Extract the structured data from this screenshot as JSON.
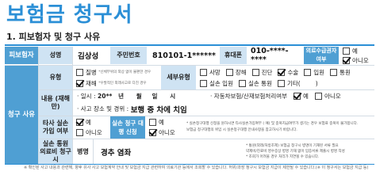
{
  "doc": {
    "title": "보험금 청구서",
    "section_title": "1. 피보험자 및 청구 사유"
  },
  "insured": {
    "header": "피보험자",
    "name_label": "성명",
    "name_value": "김상성",
    "rrn_label": "주민번호",
    "rrn_value": "810101-1******",
    "phone_label": "휴대폰",
    "phone_value": "010-****-****",
    "medical_label": "의료수급권자 여부",
    "medical_yes": "예",
    "medical_no": "아니오",
    "medical_selected": "아니오"
  },
  "claim": {
    "header": "청구 사유",
    "type_label": "유형",
    "type_disease": "질병",
    "type_disease_note": "*신체부위의 외상 없이 불편한 경우",
    "type_accident": "재해",
    "type_accident_note": "*우발적인 외래사고로 다친 경우",
    "detail_type_label": "세부유형",
    "detail_options": [
      "사망",
      "장해",
      "진단",
      "수술",
      "입원",
      "통원"
    ],
    "detail_options2": [
      "실손 입원",
      "실손 통원",
      "기타"
    ],
    "detail_selected": [
      "수술"
    ],
    "content_label": "내용 (재해만)",
    "datetime_prefix": "· 일시 :",
    "datetime_value": "20**   년      월     일      시",
    "auto_label": "· 자동차보험/산재보험처리여부",
    "auto_yes": "예",
    "auto_no": "아니오",
    "auto_selected": "예",
    "place_prefix": "· 사고 장소 및 경위 :",
    "place_value": "보행 중 차에 치임",
    "other_label": "타사 실손 가입 여부",
    "other_yes": "예",
    "other_no": "아니오",
    "other_selected": "예",
    "same_label": "실손 청구 대행 신청",
    "same_yes": "예",
    "same_no": "아니오",
    "same_selected": "아니오",
    "same_note1": "* 실손청구대행 신청을 원하시면 타사실손가입여부 ( 예) 및 중복지급여부가 생기는 경우 보험료 중복이 불가합니다.",
    "same_note2": "보험금 청구대행의 위임 시 실손청구대행 안내사항을 참고하시기 바랍니다.",
    "disease_label": "실손 통원 의료비 청구시",
    "disease_name_label": "병명",
    "disease_name_value": "경추 염좌",
    "disease_note1": "* 통원(외래/처방조제) 보험금 청구시 병명이 기재된 서류 필요",
    "disease_note2": "약제비/진료비 영수증상 병명 기재 없이 입증서류 제출시 병명 작성",
    "disease_note3": "* 조회가 어려울 경우 처리가 지연될 수 있습니다."
  },
  "footer": "※ 확인된 사고 내용과 관련해, 향후 유사 사고 보험계약 안내 및 보험금 지급 관련하여 의료기관 등에서 조회할 수 있습니다. 허위/과장 청구시 보험금 지급이 제한될 수 있습니다.(※ 이 청구서는 보험금 지급 등)",
  "colors": {
    "accent": "#2b8fd6",
    "label_dark": "#4f9fd3",
    "label_light": "#cfe3f3"
  }
}
